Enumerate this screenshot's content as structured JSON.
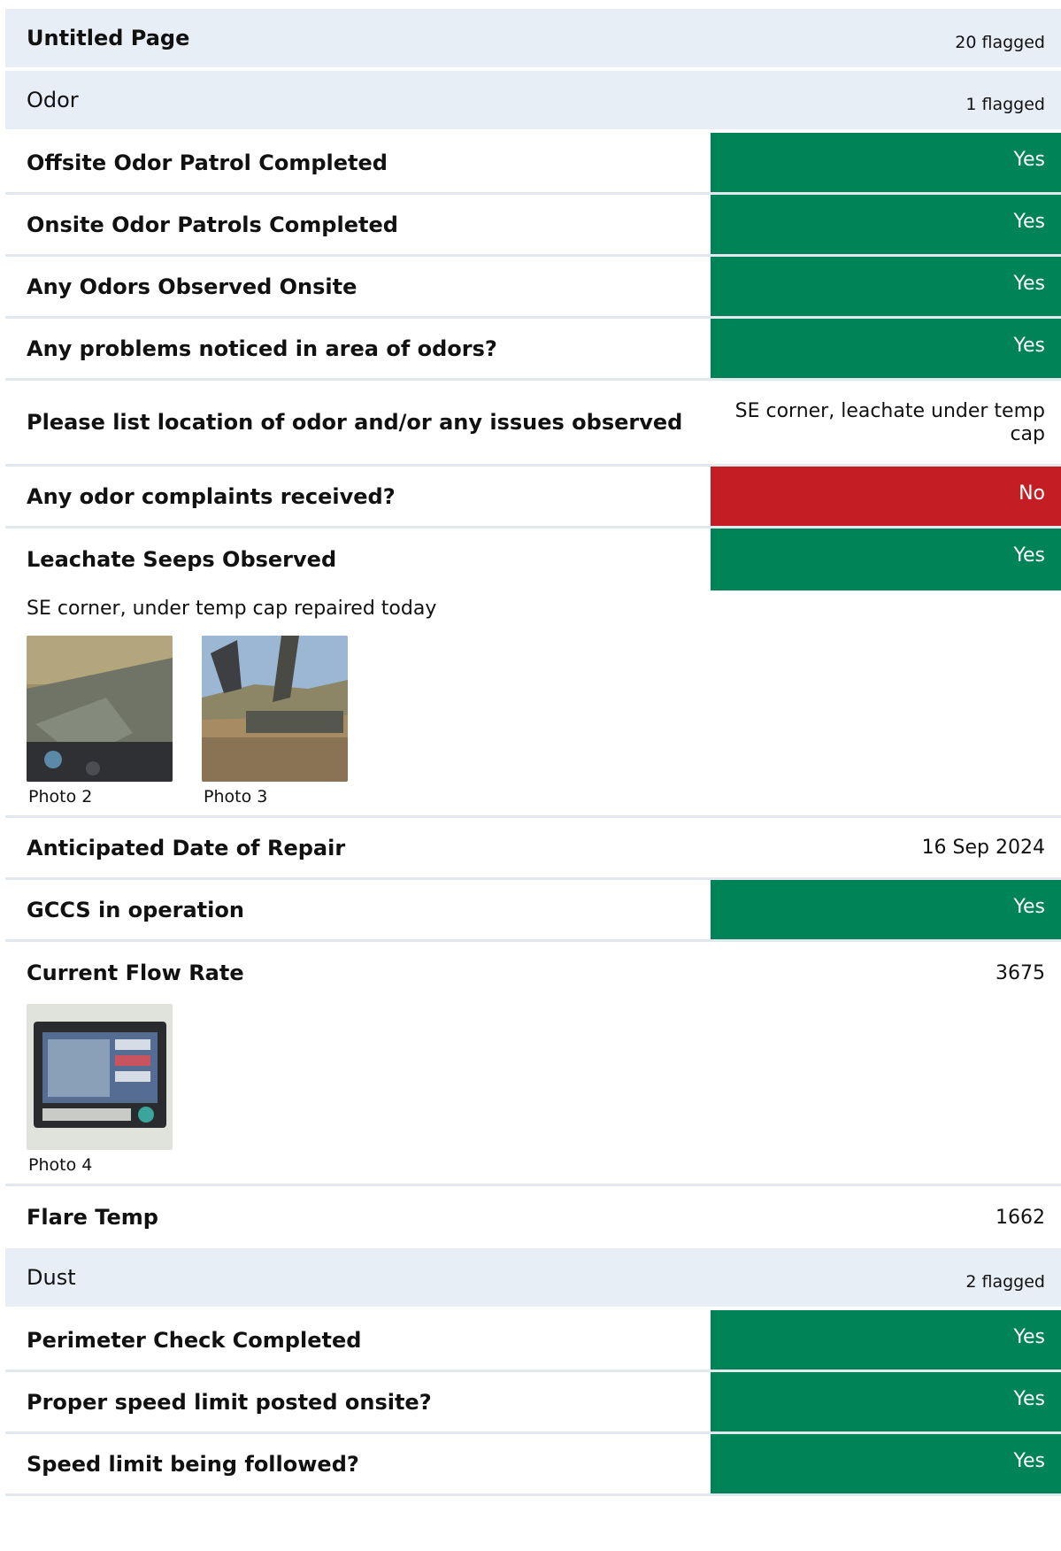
{
  "page": {
    "title": "Untitled Page",
    "flagged": "20 flagged"
  },
  "odor": {
    "title": "Odor",
    "flagged": "1 flagged",
    "rows": [
      {
        "label": "Offsite Odor Patrol Completed",
        "value": "Yes"
      },
      {
        "label": "Onsite Odor Patrols Completed",
        "value": "Yes"
      },
      {
        "label": "Any Odors Observed Onsite",
        "value": "Yes"
      },
      {
        "label": "Any problems noticed in area of odors?",
        "value": "Yes"
      },
      {
        "label": "Please list location of odor and/or any issues observed",
        "value": "SE corner, leachate under temp cap"
      },
      {
        "label": "Any odor complaints received?",
        "value": "No"
      },
      {
        "label": "Leachate Seeps Observed",
        "value": "Yes"
      }
    ],
    "leachate_note": "SE corner, under temp cap repaired today",
    "leachate_photos": [
      "Photo 2",
      "Photo 3"
    ],
    "repair": {
      "label": "Anticipated Date of Repair",
      "value": "16 Sep 2024"
    },
    "gccs": {
      "label": "GCCS in operation",
      "value": "Yes"
    },
    "flow": {
      "label": "Current Flow Rate",
      "value": "3675"
    },
    "flow_photos": [
      "Photo 4"
    ],
    "flare": {
      "label": "Flare Temp",
      "value": "1662"
    }
  },
  "dust": {
    "title": "Dust",
    "flagged": "2 flagged",
    "rows": [
      {
        "label": "Perimeter Check Completed",
        "value": "Yes"
      },
      {
        "label": "Proper speed limit posted onsite?",
        "value": "Yes"
      },
      {
        "label": "Speed limit being followed?",
        "value": "Yes"
      }
    ]
  },
  "colors": {
    "yes": "#008356",
    "no": "#c41e24",
    "header_bg": "#e8eef6"
  }
}
